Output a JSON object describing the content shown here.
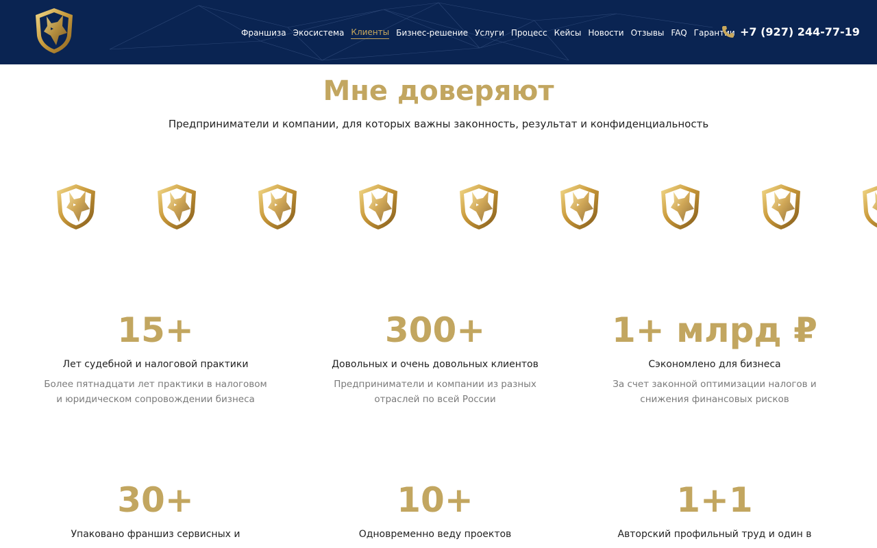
{
  "header": {
    "nav": [
      {
        "label": "Франшиза",
        "active": false
      },
      {
        "label": "Экосистема",
        "active": false
      },
      {
        "label": "Клиенты",
        "active": true
      },
      {
        "label": "Бизнес-решение",
        "active": false
      },
      {
        "label": "Услуги",
        "active": false
      },
      {
        "label": "Процесс",
        "active": false
      },
      {
        "label": "Кейсы",
        "active": false
      },
      {
        "label": "Новости",
        "active": false
      },
      {
        "label": "Отзывы",
        "active": false
      },
      {
        "label": "FAQ",
        "active": false
      },
      {
        "label": "Гарантии",
        "active": false
      }
    ],
    "phone": "+7 (927) 244-77-19",
    "phone_icon": "phone-icon",
    "logo_icon": "wolf-shield-logo"
  },
  "section": {
    "title": "Мне доверяют",
    "subtitle": "Предприниматели и компании, для которых важны законность, результат и конфиденциальность"
  },
  "client_logos": {
    "count": 9,
    "icon": "wolf-shield-logo"
  },
  "stats": [
    {
      "value": "15+",
      "label": "Лет судебной и налоговой практики",
      "desc1": "Более пятнадцати лет практики в налоговом",
      "desc2": "и юридическом сопровождении бизнеса"
    },
    {
      "value": "300+",
      "label": "Довольных и очень довольных клиентов",
      "desc1": "Предприниматели и компании из разных",
      "desc2": "отраслей по всей России"
    },
    {
      "value": "1+ млрд ₽",
      "label": "Сэкономлено для бизнеса",
      "desc1": "За счет законной оптимизации налогов и",
      "desc2": "снижения финансовых рисков"
    },
    {
      "value": "30+",
      "label": "Упаковано франшиз сервисных и",
      "desc1": "",
      "desc2": ""
    },
    {
      "value": "10+",
      "label": "Одновременно веду проектов",
      "desc1": "",
      "desc2": ""
    },
    {
      "value": "1+1",
      "label": "Авторский профильный труд и один в",
      "desc1": "",
      "desc2": ""
    }
  ],
  "colors": {
    "header_bg": "#0a2452",
    "gold": "#c2a660",
    "text": "#222222",
    "muted": "#7a7a7a"
  }
}
